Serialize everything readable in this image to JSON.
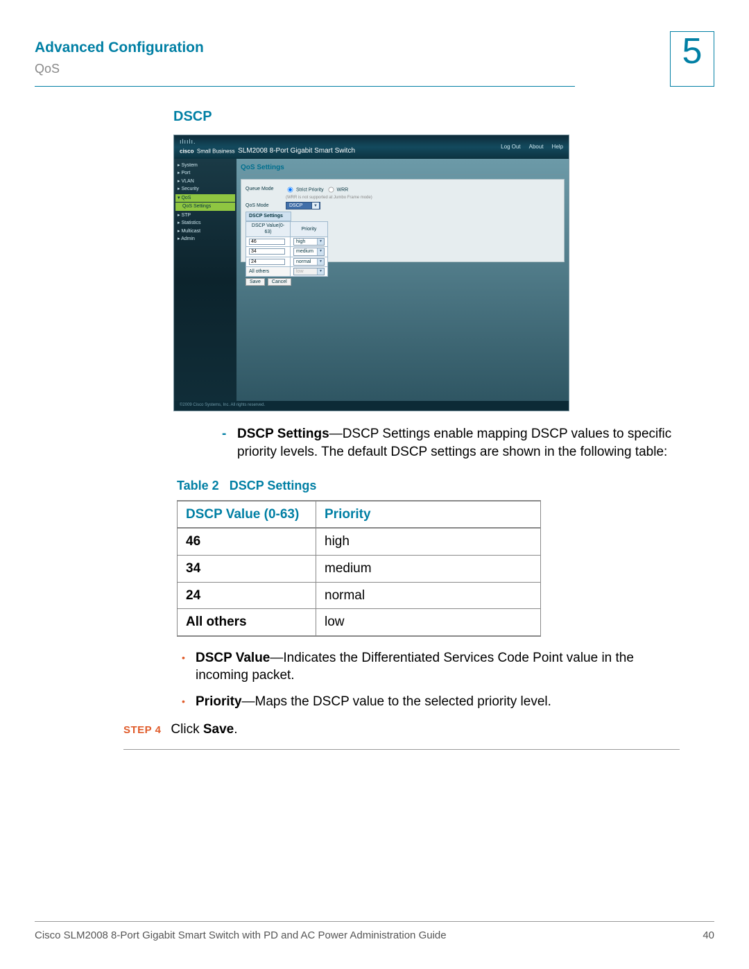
{
  "header": {
    "title": "Advanced Configuration",
    "subtitle": "QoS",
    "chapter": "5"
  },
  "section": {
    "title": "DSCP"
  },
  "screenshot": {
    "brand_small": "Small Business",
    "brand_name": "SLM2008 8-Port Gigabit Smart Switch",
    "links": {
      "logout": "Log Out",
      "about": "About",
      "help": "Help"
    },
    "side": {
      "system": "▸ System",
      "port": "▸ Port",
      "vlan": "▸ VLAN",
      "security": "▸ Security",
      "qos": "▾ QoS",
      "qos_settings": "QoS Settings",
      "stp": "▸ STP",
      "statistics": "▸ Statistics",
      "multicast": "▸ Multicast",
      "admin": "▸ Admin"
    },
    "panel_title": "QoS Settings",
    "queue_mode_label": "Queue Mode",
    "queue_mode_opt1": "Strict Priority",
    "queue_mode_opt2": "WRR",
    "queue_mode_note": "(WRR is not supported at Jumbo Frame mode)",
    "qos_mode_label": "QoS Mode",
    "qos_mode_value": "DSCP",
    "tbl_hdr": "DSCP Settings",
    "tbl_c1": "DSCP Value(0-63)",
    "tbl_c2": "Priority",
    "row1": {
      "v": "46",
      "p": "high"
    },
    "row2": {
      "v": "34",
      "p": "medium"
    },
    "row3": {
      "v": "24",
      "p": "normal"
    },
    "row4": {
      "v": "All others",
      "p": "low"
    },
    "btn_save": "Save",
    "btn_cancel": "Cancel",
    "footer": "©2009 Cisco Systems, Inc. All rights reserved.",
    "imgref": "194427"
  },
  "desc": {
    "lead": "DSCP Settings",
    "text": "—DSCP Settings enable mapping DSCP values to specific priority levels. The default DSCP settings are shown in the following table:"
  },
  "table": {
    "caption_label": "Table 2",
    "caption_title": "DSCP Settings",
    "head_c1": "DSCP Value (0-63)",
    "head_c2": "Priority",
    "rows": [
      {
        "c1": "46",
        "c2": "high"
      },
      {
        "c1": "34",
        "c2": "medium"
      },
      {
        "c1": "24",
        "c2": "normal"
      },
      {
        "c1": "All others",
        "c2": "low"
      }
    ]
  },
  "bullets": {
    "b1_lead": "DSCP Value",
    "b1_text": "—Indicates the Differentiated Services Code Point value in the incoming packet.",
    "b2_lead": "Priority",
    "b2_text": "—Maps the DSCP value to the selected priority level."
  },
  "step": {
    "label": "STEP 4",
    "text_pre": "Click ",
    "text_bold": "Save",
    "text_post": "."
  },
  "footer": {
    "left": "Cisco SLM2008 8-Port Gigabit Smart Switch with PD and AC Power Administration Guide",
    "right": "40"
  }
}
